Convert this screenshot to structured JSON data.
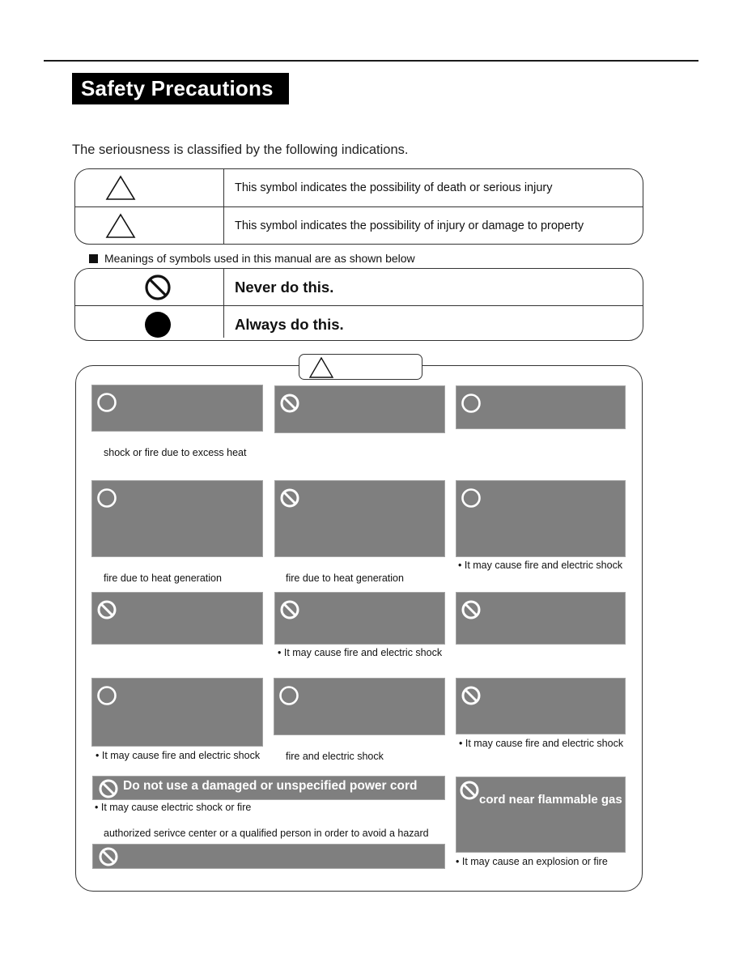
{
  "page": {
    "title": "Safety Precautions",
    "intro": "The seriousness is classified by the following indications."
  },
  "seriousness_table": {
    "rows": [
      {
        "icon": "warning-triangle-icon",
        "text": "This symbol indicates the possibility of death or serious injury"
      },
      {
        "icon": "caution-triangle-icon",
        "text": "This symbol indicates the possibility of injury or damage to property"
      }
    ]
  },
  "symbols_section": {
    "label": "Meanings of symbols used in this manual are as shown below",
    "rows": [
      {
        "icon": "prohibited-icon",
        "text": "Never do this."
      },
      {
        "icon": "mandatory-icon",
        "text": "Always do this."
      }
    ]
  },
  "warning_panel": {
    "tab_icon": "warning-triangle-icon",
    "items": [
      {
        "icon": "mandatory-ring-icon",
        "title": "",
        "note": "shock or fire due to excess heat"
      },
      {
        "icon": "prohibited-icon",
        "title": "",
        "note": ""
      },
      {
        "icon": "mandatory-ring-icon",
        "title": "",
        "note": ""
      },
      {
        "icon": "mandatory-ring-icon",
        "title": "",
        "note": "fire due to heat generation"
      },
      {
        "icon": "prohibited-icon",
        "title": "",
        "note": "fire due to heat generation"
      },
      {
        "icon": "mandatory-ring-icon",
        "title": "",
        "note": "• It may cause fire and electric shock"
      },
      {
        "icon": "prohibited-icon",
        "title": "",
        "note": ""
      },
      {
        "icon": "prohibited-icon",
        "title": "",
        "note": "• It may cause fire and electric shock"
      },
      {
        "icon": "prohibited-icon",
        "title": "",
        "note": ""
      },
      {
        "icon": "mandatory-ring-icon",
        "title": "",
        "note": "• It may cause fire and electric shock"
      },
      {
        "icon": "mandatory-ring-icon",
        "title": "",
        "note": "fire and electric shock"
      },
      {
        "icon": "prohibited-icon",
        "title": "",
        "note": "• It may cause fire and electric shock"
      },
      {
        "icon": "prohibited-icon",
        "title": "Do not use a damaged or unspecified power cord",
        "note": "• It may cause electric shock or fire",
        "note2": "authorized serivce center or a qualified person in order to avoid a hazard"
      },
      {
        "icon": "prohibited-icon",
        "title": "cord near flammable gas",
        "note": "• It may cause an explosion or fire"
      },
      {
        "icon": "prohibited-icon",
        "title": "",
        "note": ""
      }
    ]
  },
  "colors": {
    "title_bg": "#000000",
    "box_fill": "#7f7f7f",
    "box_border": "#a3a3a3",
    "line": "#333333"
  }
}
